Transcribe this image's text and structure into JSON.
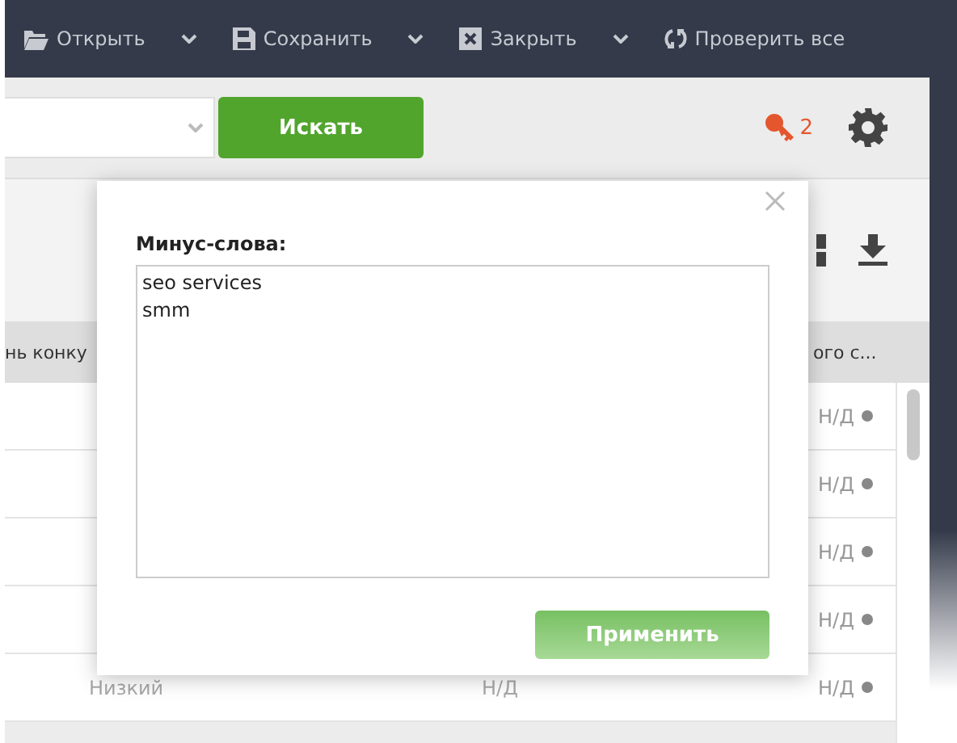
{
  "toolbar": [
    {
      "kind": "open",
      "label": "Открыть",
      "dropdown": true
    },
    {
      "kind": "save",
      "label": "Сохранить",
      "dropdown": true
    },
    {
      "kind": "close",
      "label": "Закрыть",
      "dropdown": true
    },
    {
      "kind": "refresh",
      "label": "Проверить все",
      "dropdown": false
    }
  ],
  "search": {
    "button": "Искать",
    "keys_count": "2"
  },
  "table": {
    "columns": [
      "нь конку",
      "ого с..."
    ],
    "rows": [
      {
        "column_3": "Н/Д"
      },
      {
        "column_3": "Н/Д"
      },
      {
        "column_3": "Н/Д"
      },
      {
        "column_3": "Н/Д"
      },
      {
        "column_1": "Низкий",
        "column_2": "Н/Д",
        "column_3": "Н/Д"
      }
    ]
  },
  "dialog": {
    "label": "Минус-слова:",
    "value": "seo services\nsmm",
    "button": "Применить"
  }
}
